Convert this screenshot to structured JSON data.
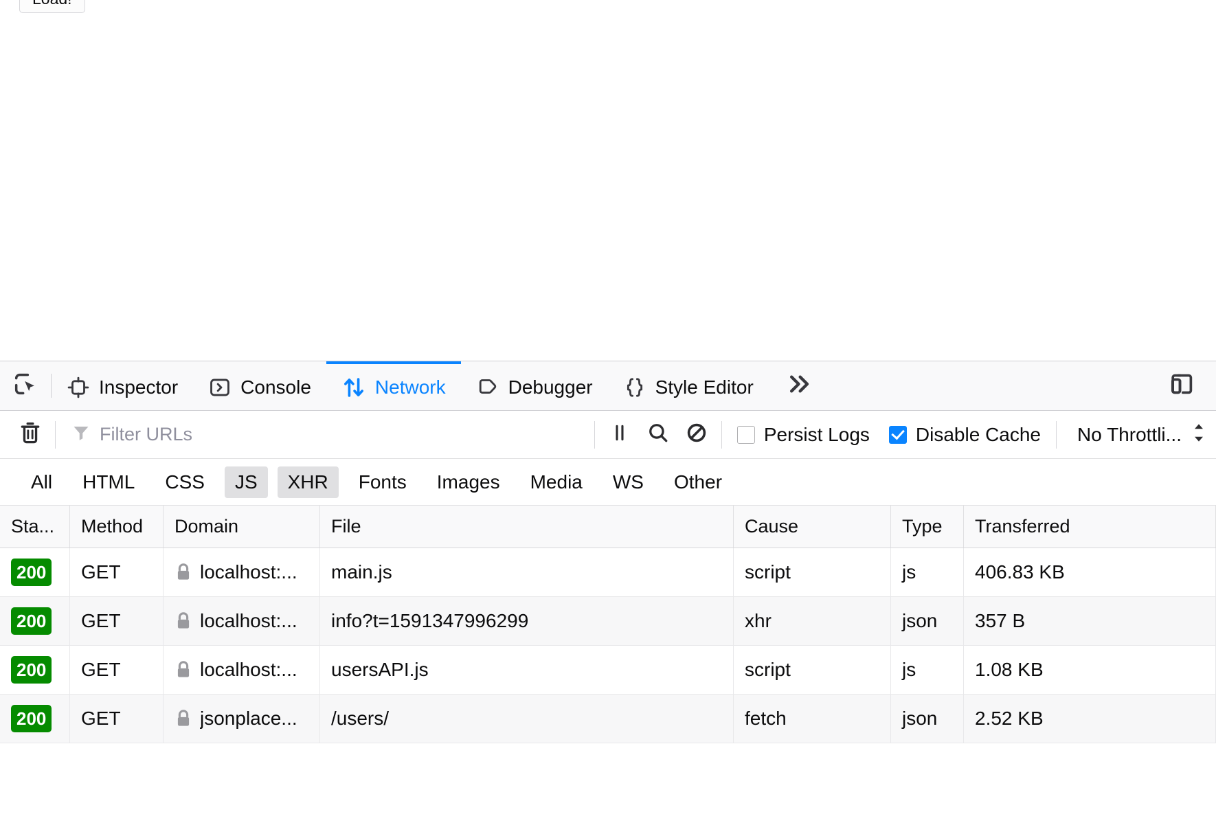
{
  "page": {
    "load_button_label": "Load!"
  },
  "devtools": {
    "picker_icon": "element-picker-icon",
    "tabs": [
      {
        "label": "Inspector",
        "icon": "inspector-icon",
        "active": false
      },
      {
        "label": "Console",
        "icon": "console-icon",
        "active": false
      },
      {
        "label": "Network",
        "icon": "network-arrows-icon",
        "active": true
      },
      {
        "label": "Debugger",
        "icon": "debugger-icon",
        "active": false
      },
      {
        "label": "Style Editor",
        "icon": "style-editor-icon",
        "active": false
      }
    ],
    "overflow_icon": "chevron-double-right-icon",
    "responsive_icon": "responsive-design-mode-icon",
    "accent_color": "#0a84ff"
  },
  "toolbar": {
    "clear_icon": "trash-icon",
    "filter_icon": "funnel-icon",
    "filter_placeholder": "Filter URLs",
    "filter_value": "",
    "pause_icon": "pause-icon",
    "search_icon": "search-icon",
    "block_icon": "block-icon",
    "persist_logs_label": "Persist Logs",
    "persist_logs_checked": false,
    "disable_cache_label": "Disable Cache",
    "disable_cache_checked": true,
    "throttling_value": "No Throttli...",
    "throttling_icon": "updown-arrows-icon"
  },
  "type_filters": [
    {
      "label": "All",
      "selected": false
    },
    {
      "label": "HTML",
      "selected": false
    },
    {
      "label": "CSS",
      "selected": false
    },
    {
      "label": "JS",
      "selected": true
    },
    {
      "label": "XHR",
      "selected": true
    },
    {
      "label": "Fonts",
      "selected": false
    },
    {
      "label": "Images",
      "selected": false
    },
    {
      "label": "Media",
      "selected": false
    },
    {
      "label": "WS",
      "selected": false
    },
    {
      "label": "Other",
      "selected": false
    }
  ],
  "table": {
    "columns": [
      "Sta...",
      "Method",
      "Domain",
      "File",
      "Cause",
      "Type",
      "Transferred"
    ],
    "rows": [
      {
        "status": "200",
        "method": "GET",
        "domain": "localhost:...",
        "secure": true,
        "file": "main.js",
        "cause": "script",
        "type": "js",
        "transferred": "406.83 KB"
      },
      {
        "status": "200",
        "method": "GET",
        "domain": "localhost:...",
        "secure": true,
        "file": "info?t=1591347996299",
        "cause": "xhr",
        "type": "json",
        "transferred": "357 B"
      },
      {
        "status": "200",
        "method": "GET",
        "domain": "localhost:...",
        "secure": true,
        "file": "usersAPI.js",
        "cause": "script",
        "type": "js",
        "transferred": "1.08 KB"
      },
      {
        "status": "200",
        "method": "GET",
        "domain": "jsonplace...",
        "secure": true,
        "file": "/users/",
        "cause": "fetch",
        "type": "json",
        "transferred": "2.52 KB"
      }
    ]
  },
  "colors": {
    "status_ok_bg": "#058b00",
    "accent": "#0a84ff",
    "toolbar_bg": "#f9f9fa"
  }
}
